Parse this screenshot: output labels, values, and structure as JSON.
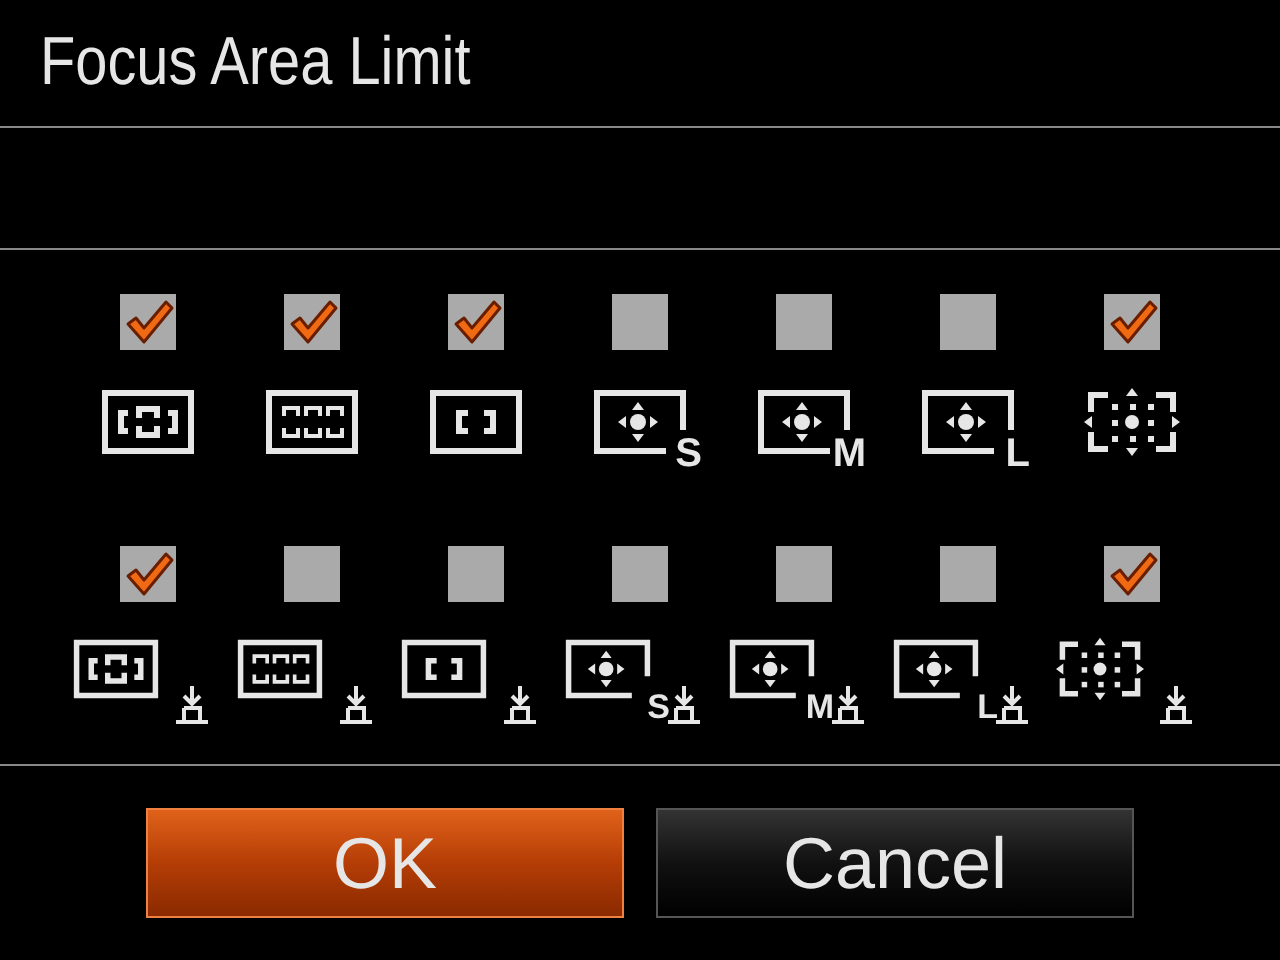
{
  "title": "Focus Area Limit",
  "rows": [
    {
      "tracking": false,
      "items": [
        {
          "kind": "wide",
          "checked": true
        },
        {
          "kind": "zone",
          "checked": true
        },
        {
          "kind": "center",
          "checked": true
        },
        {
          "kind": "spot",
          "size": "S",
          "checked": false
        },
        {
          "kind": "spot",
          "size": "M",
          "checked": false
        },
        {
          "kind": "spot",
          "size": "L",
          "checked": false
        },
        {
          "kind": "expand",
          "checked": true
        }
      ]
    },
    {
      "tracking": true,
      "items": [
        {
          "kind": "wide",
          "checked": true
        },
        {
          "kind": "zone",
          "checked": false
        },
        {
          "kind": "center",
          "checked": false
        },
        {
          "kind": "spot",
          "size": "S",
          "checked": false
        },
        {
          "kind": "spot",
          "size": "M",
          "checked": false
        },
        {
          "kind": "spot",
          "size": "L",
          "checked": false
        },
        {
          "kind": "expand",
          "checked": true
        }
      ]
    }
  ],
  "buttons": [
    {
      "label": "OK",
      "selected": true
    },
    {
      "label": "Cancel",
      "selected": false
    }
  ]
}
